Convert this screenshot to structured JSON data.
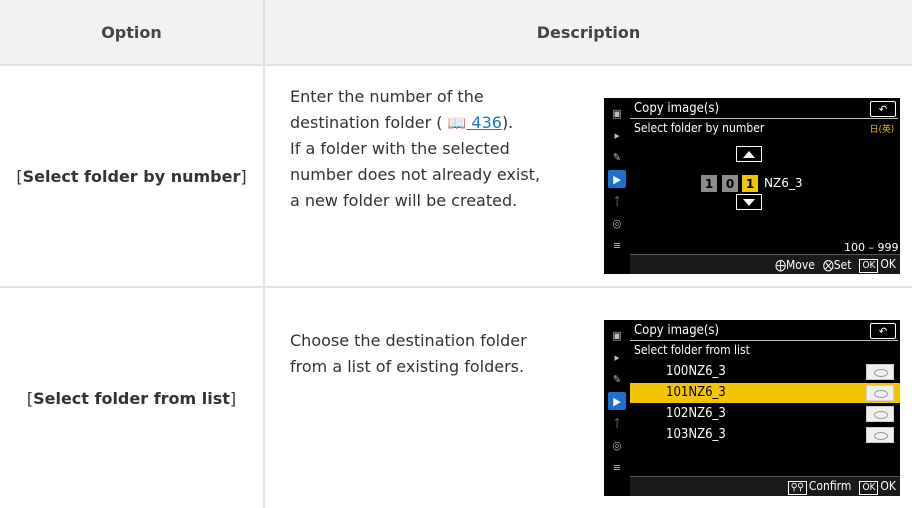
{
  "header": {
    "option": "Option",
    "description": "Description"
  },
  "rows": [
    {
      "option": "Select folder by number",
      "description_lines": [
        "Enter the number of the",
        "destination folder (",
        "436",
        ").",
        "If a folder with the selected",
        "number does not already exist,",
        "a new folder will be created."
      ],
      "screen": {
        "title": "Copy image(s)",
        "subtitle": "Select folder by number",
        "lang_badge": "日(英)",
        "digits": [
          "1",
          "0",
          "1"
        ],
        "folder_suffix": "NZ6_3",
        "range": "100 – 999",
        "footer_move": "Move",
        "footer_set": "Set",
        "footer_ok_badge": "OK",
        "footer_ok": "OK"
      }
    },
    {
      "option": "Select folder from list",
      "description_lines": [
        "Choose the destination folder",
        "from a list of existing folders."
      ],
      "screen": {
        "title": "Copy image(s)",
        "subtitle": "Select folder from list",
        "folders": [
          "100NZ6_3",
          "101NZ6_3",
          "102NZ6_3",
          "103NZ6_3"
        ],
        "selected_index": 1,
        "footer_confirm": "Confirm",
        "footer_ok_badge": "OK",
        "footer_ok": "OK"
      }
    }
  ],
  "colors": {
    "accent_yellow": "#f2c500",
    "link_blue": "#1a73c8",
    "side_selected": "#1f6fd1"
  },
  "icons": [
    "camera-icon",
    "movie-icon",
    "pencil-icon",
    "playback-icon",
    "wrench-icon",
    "network-icon",
    "my-menu-icon",
    "back-icon"
  ]
}
